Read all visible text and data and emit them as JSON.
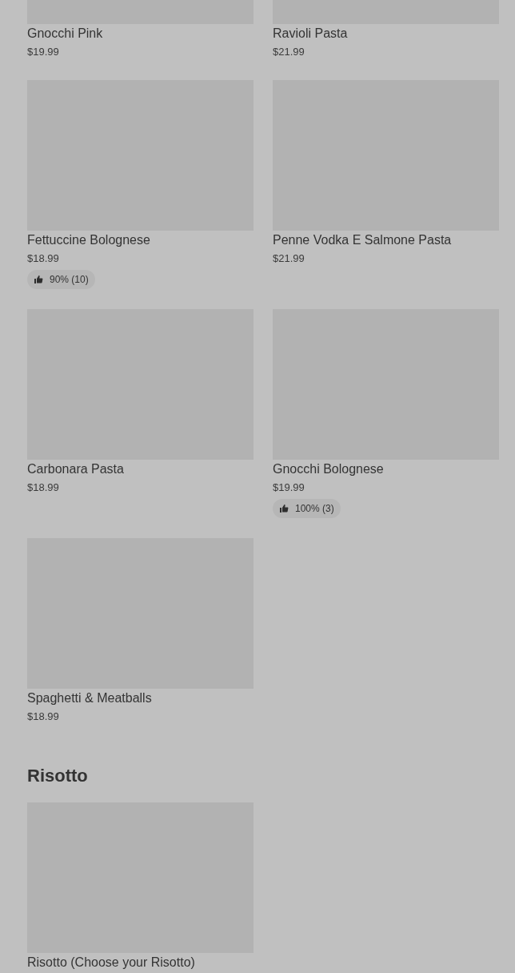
{
  "sections": [
    {
      "items": [
        {
          "name": "Gnocchi Pink",
          "price": "$19.99"
        },
        {
          "name": "Ravioli Pasta",
          "price": "$21.99"
        },
        {
          "name": "Fettuccine Bolognese",
          "price": "$18.99",
          "rating": "90% (10)"
        },
        {
          "name": "Penne Vodka E Salmone Pasta",
          "price": "$21.99"
        },
        {
          "name": "Carbonara Pasta",
          "price": "$18.99"
        },
        {
          "name": "Gnocchi Bolognese",
          "price": "$19.99",
          "rating": "100% (3)"
        },
        {
          "name": "Spaghetti & Meatballs",
          "price": "$18.99"
        }
      ]
    },
    {
      "title": "Risotto",
      "items": [
        {
          "name": "Risotto (Choose your Risotto)"
        }
      ]
    }
  ]
}
